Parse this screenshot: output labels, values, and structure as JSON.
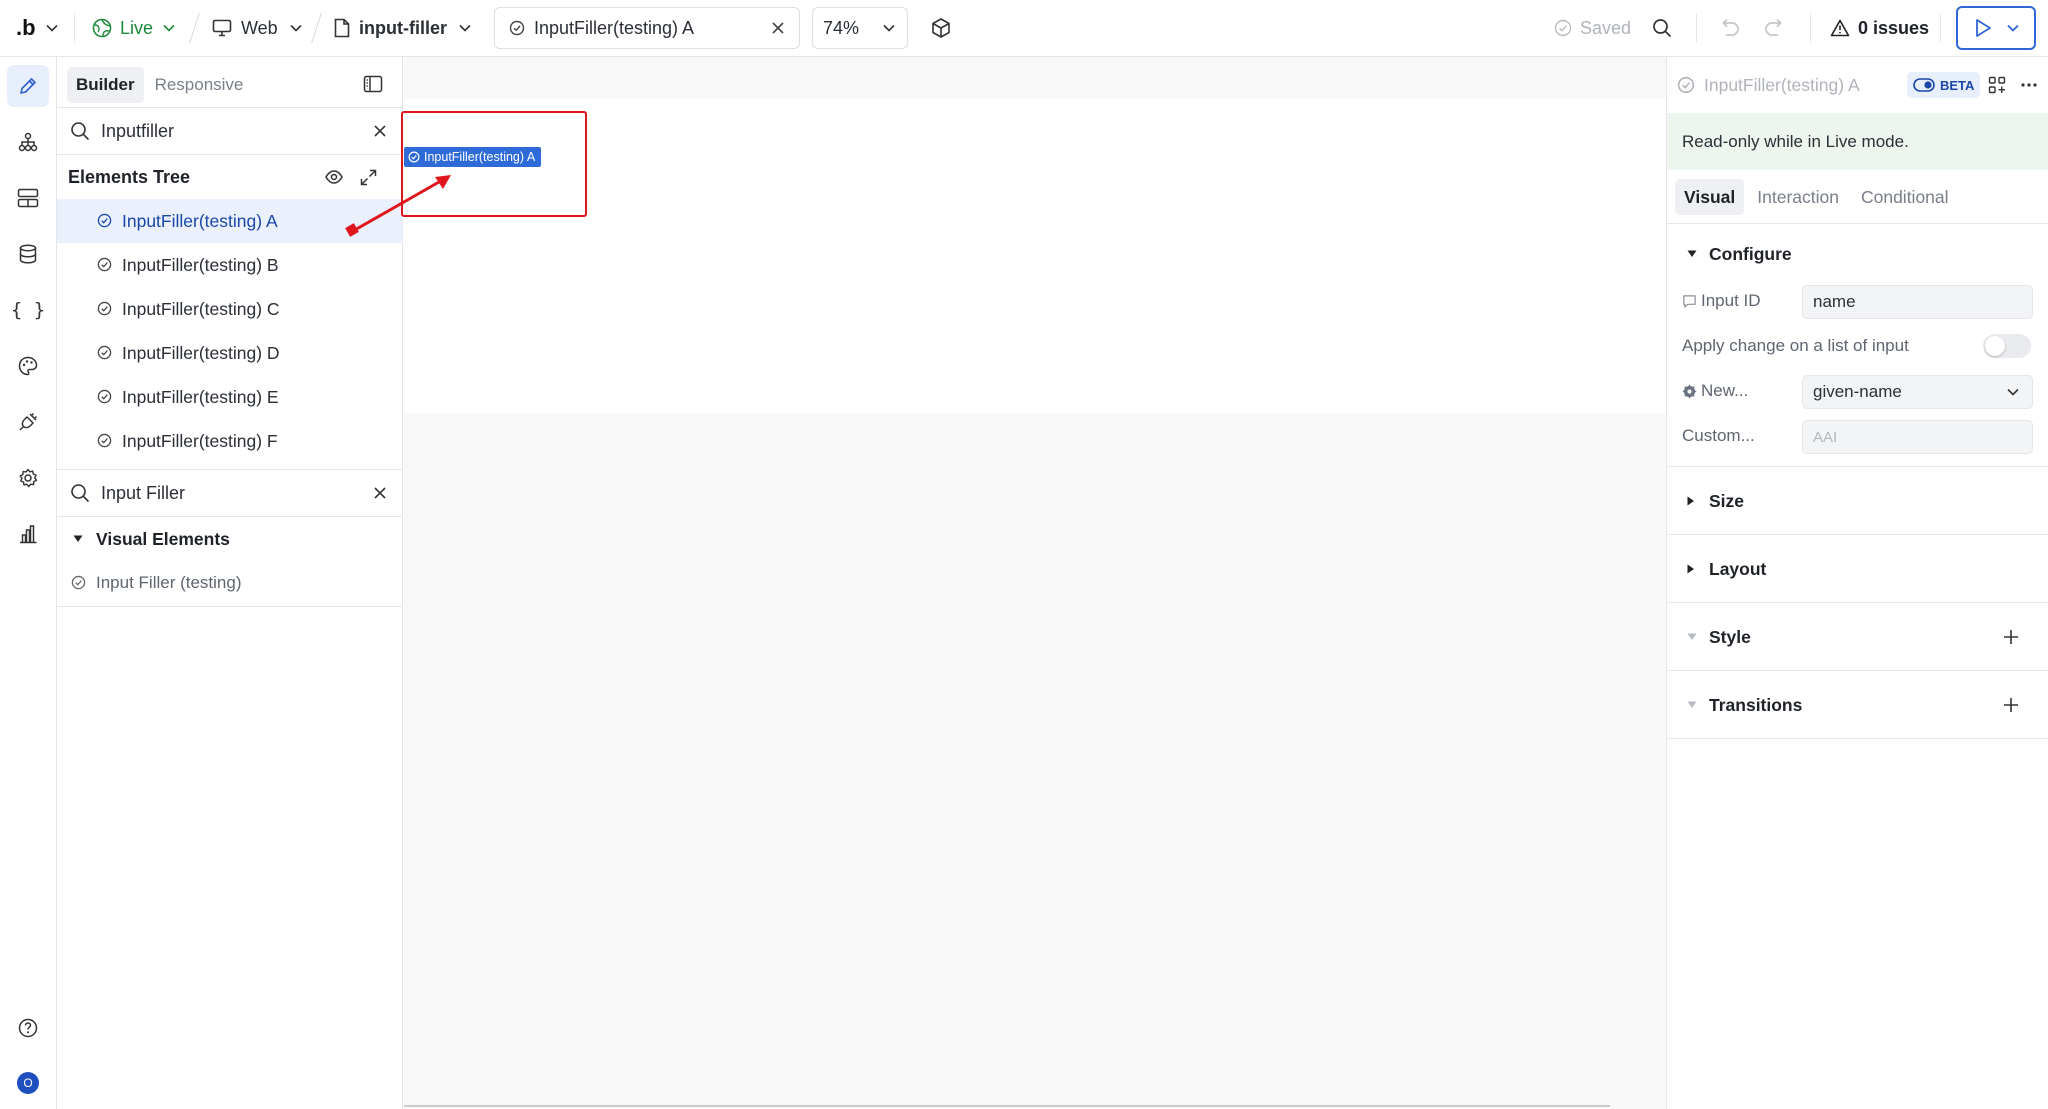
{
  "topbar": {
    "logo": ".b",
    "live_label": "Live",
    "platform_label": "Web",
    "page_label": "input-filler",
    "element_tab_label": "InputFiller(testing) A",
    "zoom_label": "74%",
    "saved_label": "Saved",
    "issues_label": "0 issues",
    "colors": {
      "live": "#1f8a3b",
      "accent": "#3166d6"
    }
  },
  "left_panel": {
    "tabs": [
      "Builder",
      "Responsive"
    ],
    "active_tab": "Builder",
    "search1": {
      "value": "Inputfiller"
    },
    "tree_header": "Elements Tree",
    "tree_items": [
      "InputFiller(testing) A",
      "InputFiller(testing) B",
      "InputFiller(testing) C",
      "InputFiller(testing) D",
      "InputFiller(testing) E",
      "InputFiller(testing) F"
    ],
    "selected_item": "InputFiller(testing) A",
    "search2": {
      "value": "Input Filler"
    },
    "visual_header": "Visual Elements",
    "visual_items": [
      "Input Filler (testing)"
    ]
  },
  "canvas": {
    "element_tag": "InputFiller(testing) A",
    "highlight_color": "#e0161e"
  },
  "right_panel": {
    "title": "InputFiller(testing) A",
    "beta_label": "BETA",
    "notice": "Read-only while in Live mode.",
    "tabs": [
      "Visual",
      "Interaction",
      "Conditional"
    ],
    "active_tab": "Visual",
    "configure": {
      "title": "Configure",
      "input_id_label": "Input ID",
      "input_id_value": "name",
      "apply_change_label": "Apply change on a list of input",
      "apply_change_on": false,
      "new_label": "New...",
      "new_value": "given-name",
      "custom_label": "Custom...",
      "custom_placeholder": "AAI"
    },
    "sections": [
      "Size",
      "Layout",
      "Style",
      "Transitions"
    ]
  }
}
